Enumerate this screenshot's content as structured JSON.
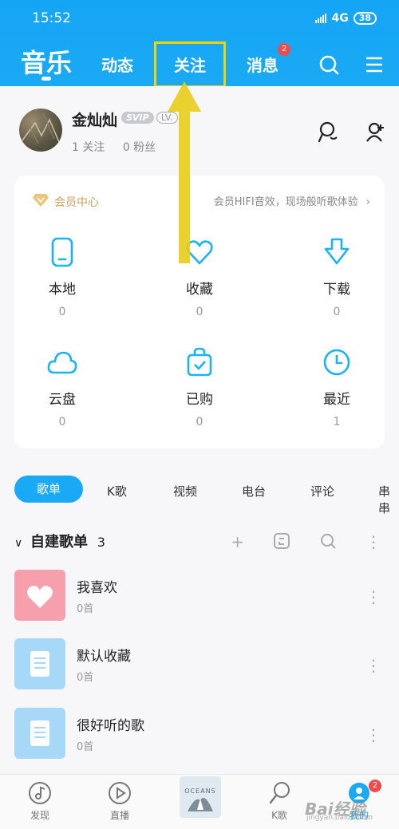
{
  "status_bar": {
    "time": "15:52",
    "network": "4G",
    "battery": "38"
  },
  "header": {
    "tabs": [
      {
        "label": "音乐"
      },
      {
        "label": "动态"
      },
      {
        "label": "关注"
      },
      {
        "label": "消息",
        "badge": "2"
      }
    ]
  },
  "profile": {
    "name": "金灿灿",
    "svip": "SVIP",
    "level": "LV.",
    "follow": "1 关注",
    "fans": "0 粉丝"
  },
  "vip": {
    "title": "会员中心",
    "description": "会员HIFI音效，现场般听歌体验"
  },
  "library": [
    {
      "label": "本地",
      "count": "0"
    },
    {
      "label": "收藏",
      "count": "0"
    },
    {
      "label": "下载",
      "count": "0"
    },
    {
      "label": "云盘",
      "count": "0"
    },
    {
      "label": "已购",
      "count": "0"
    },
    {
      "label": "最近",
      "count": "1"
    }
  ],
  "content_tabs": [
    "歌单",
    "K歌",
    "视频",
    "电台",
    "评论",
    "串串"
  ],
  "section": {
    "title": "自建歌单",
    "count": "3"
  },
  "playlists": [
    {
      "name": "我喜欢",
      "count": "0首"
    },
    {
      "name": "默认收藏",
      "count": "0首"
    },
    {
      "name": "很好听的歌",
      "count": "0首"
    }
  ],
  "bottom_nav": [
    {
      "label": "发现"
    },
    {
      "label": "直播"
    },
    {
      "label": "OCEANS"
    },
    {
      "label": "K歌"
    },
    {
      "label": "我的",
      "badge": "2"
    }
  ],
  "watermark": {
    "main": "Bai经验",
    "sub": "jingyan.baidu.com"
  },
  "colors": {
    "accent": "#1aa9f4",
    "vip_gold": "#c9a25b",
    "highlight": "#f2d400"
  }
}
